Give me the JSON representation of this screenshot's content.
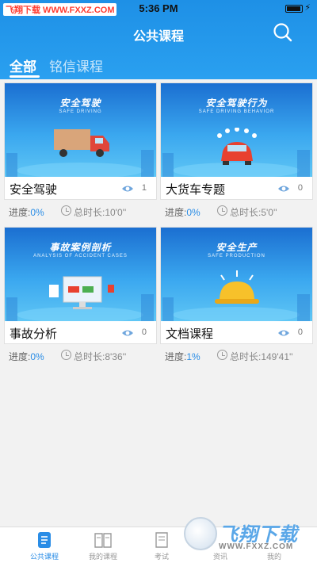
{
  "statusbar": {
    "carrier": "飞翔下载 WWW.FXXZ.COM",
    "time": "5:36 PM"
  },
  "header": {
    "title": "公共课程"
  },
  "tabs": [
    {
      "label": "全部"
    },
    {
      "label": "铭信课程"
    }
  ],
  "courses": [
    {
      "name": "安全驾驶",
      "views": "1",
      "thumb_title": "安全驾驶",
      "thumb_sub": "SAFE DRIVING",
      "progress_label": "进度:",
      "progress": "0%",
      "duration": "总时长:10'0''"
    },
    {
      "name": "大货车专题",
      "views": "0",
      "thumb_title": "安全驾驶行为",
      "thumb_sub": "SAFE DRIVING BEHAVIOR",
      "progress_label": "进度:",
      "progress": "0%",
      "duration": "总时长:5'0''"
    },
    {
      "name": "事故分析",
      "views": "0",
      "thumb_title": "事故案例剖析",
      "thumb_sub": "ANALYSIS OF ACCIDENT CASES",
      "progress_label": "进度:",
      "progress": "0%",
      "duration": "总时长:8'36''"
    },
    {
      "name": "文档课程",
      "views": "0",
      "thumb_title": "安全生产",
      "thumb_sub": "SAFE PRODUCTION",
      "progress_label": "进度:",
      "progress": "1%",
      "duration": "总时长:149'41''"
    }
  ],
  "tabbar": [
    {
      "label": "公共课程",
      "icon": "doc-list-icon"
    },
    {
      "label": "我的课程",
      "icon": "book-icon"
    },
    {
      "label": "考试",
      "icon": "scroll-icon"
    },
    {
      "label": "资讯",
      "icon": "news-icon"
    },
    {
      "label": "我的",
      "icon": "user-icon"
    }
  ],
  "watermark": {
    "text": "飞翔下载",
    "url": "WWW.FXXZ.COM"
  },
  "colors": {
    "header": "#1e90e6",
    "accent": "#2a8de6"
  }
}
